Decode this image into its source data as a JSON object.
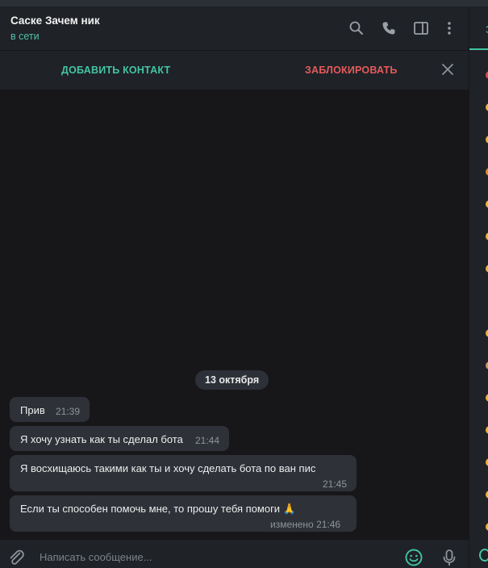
{
  "header": {
    "title": "Саске Зачем ник",
    "status": "в сети"
  },
  "actionbar": {
    "add_contact": "ДОБАВИТЬ КОНТАКТ",
    "block": "ЗАБЛОКИРОВАТЬ"
  },
  "chat": {
    "date": "13 октября",
    "messages": [
      {
        "text": "Прив",
        "time": "21:39"
      },
      {
        "text": "Я хочу узнать как ты сделал бота",
        "time": "21:44"
      },
      {
        "text": "Я восхищаюсь такими как ты и хочу сделать бота по ван пис",
        "time": "21:45"
      },
      {
        "text": "Если ты способен помочь мне, то прошу тебя помоги 🙏",
        "time": "изменено 21:46"
      }
    ]
  },
  "composer": {
    "placeholder": "Написать сообщение..."
  },
  "right_panel": {
    "tab_label": "З"
  },
  "colors": {
    "accent": "#43c4a3",
    "danger": "#e45b5b",
    "bubble": "#2e3138"
  }
}
